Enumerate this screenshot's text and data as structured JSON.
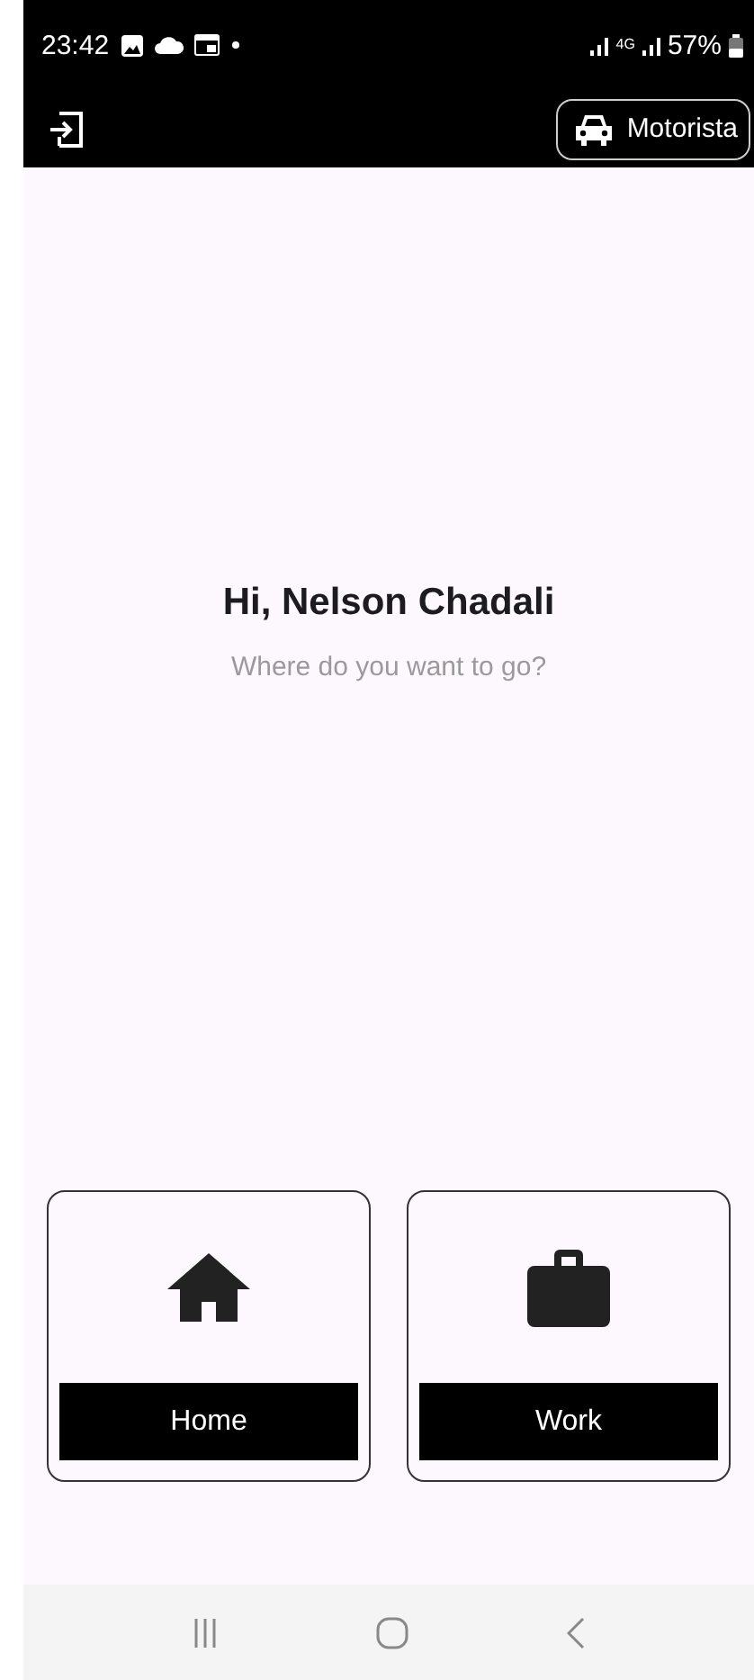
{
  "status_bar": {
    "time": "23:42",
    "network": "4G",
    "battery": "57%"
  },
  "app_bar": {
    "mode_button": "Motorista"
  },
  "greeting": {
    "title": "Hi, Nelson Chadali",
    "subtitle": "Where do you want to go?"
  },
  "places": [
    {
      "kind": "home",
      "label": "Home"
    },
    {
      "kind": "work",
      "label": "Work"
    }
  ]
}
